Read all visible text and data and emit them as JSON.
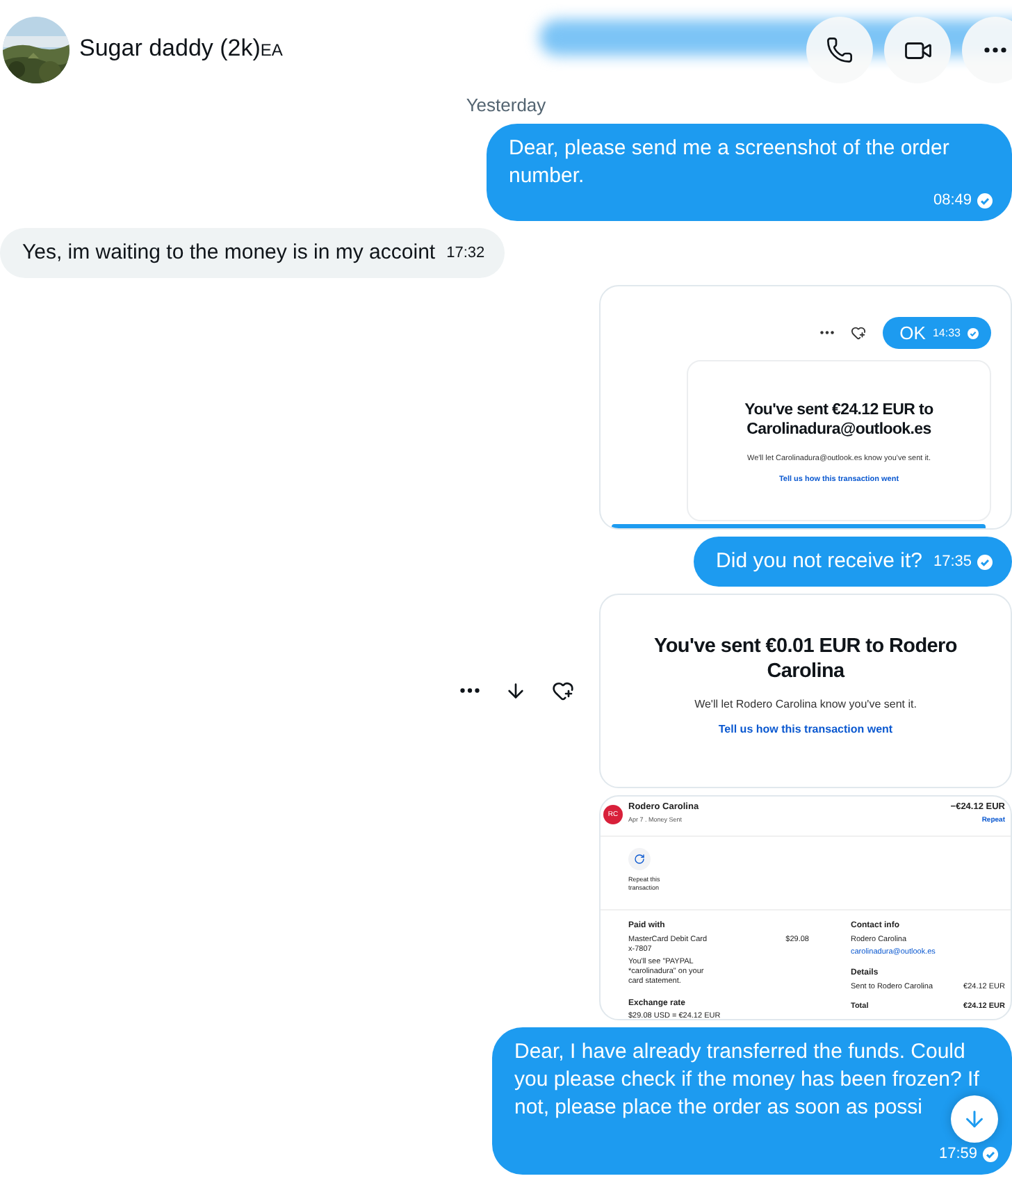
{
  "header": {
    "name": "Sugar daddy (2k)",
    "badge": "EA"
  },
  "date_divider": "Yesterday",
  "messages": [
    {
      "kind": "text",
      "outgoing": true,
      "text": "Dear, please send me a screenshot of the order number.",
      "time": "08:49",
      "read": true
    },
    {
      "kind": "text",
      "outgoing": false,
      "text": "Yes, im waiting to the money is in my accoint",
      "time": "17:32"
    },
    {
      "kind": "chat_receipt",
      "outgoing": true,
      "reply": {
        "text": "OK",
        "time": "14:33",
        "read": true
      },
      "title": "You've sent €24.12 EUR to Carolinadura@outlook.es",
      "note": "We'll let Carolinadura@outlook.es know you've sent it.",
      "link": "Tell us how this transaction went"
    },
    {
      "kind": "text",
      "outgoing": true,
      "text": "Did you not receive it?",
      "time": "17:35",
      "read": true
    },
    {
      "kind": "receipt",
      "outgoing": true,
      "show_actions": true,
      "title": "You've sent €0.01 EUR to Rodero Carolina",
      "note": "We'll let Rodero Carolina know you've sent it.",
      "link": "Tell us how this transaction went"
    },
    {
      "kind": "transaction",
      "outgoing": true,
      "transaction": {
        "initials": "RC",
        "name": "Rodero Carolina",
        "subtitle": "Apr 7 . Money Sent",
        "amount": "−€24.12 EUR",
        "repeat_link": "Repeat",
        "repeat_label": "Repeat this transaction",
        "paid_with": {
          "heading": "Paid with",
          "card": "MasterCard Debit Card x-7807",
          "amount": "$29.08",
          "note": "You'll see \"PAYPAL *carolinadura\" on your card statement."
        },
        "exchange": {
          "heading": "Exchange rate",
          "value": "$29.08 USD = €24.12 EUR"
        },
        "contact": {
          "heading": "Contact info",
          "name": "Rodero Carolina",
          "email": "carolinadura@outlook.es"
        },
        "details": {
          "heading": "Details",
          "rows": [
            {
              "label": "Sent to Rodero Carolina",
              "value": "€24.12 EUR"
            },
            {
              "label": "Total",
              "value": "€24.12 EUR"
            }
          ]
        }
      }
    },
    {
      "kind": "text",
      "outgoing": true,
      "text": "Dear, I have already transferred the funds. Could you please check if the money has been frozen? If not, please place the order as soon as possi",
      "time": "17:59",
      "read": true
    }
  ],
  "scroll_down_button": true
}
